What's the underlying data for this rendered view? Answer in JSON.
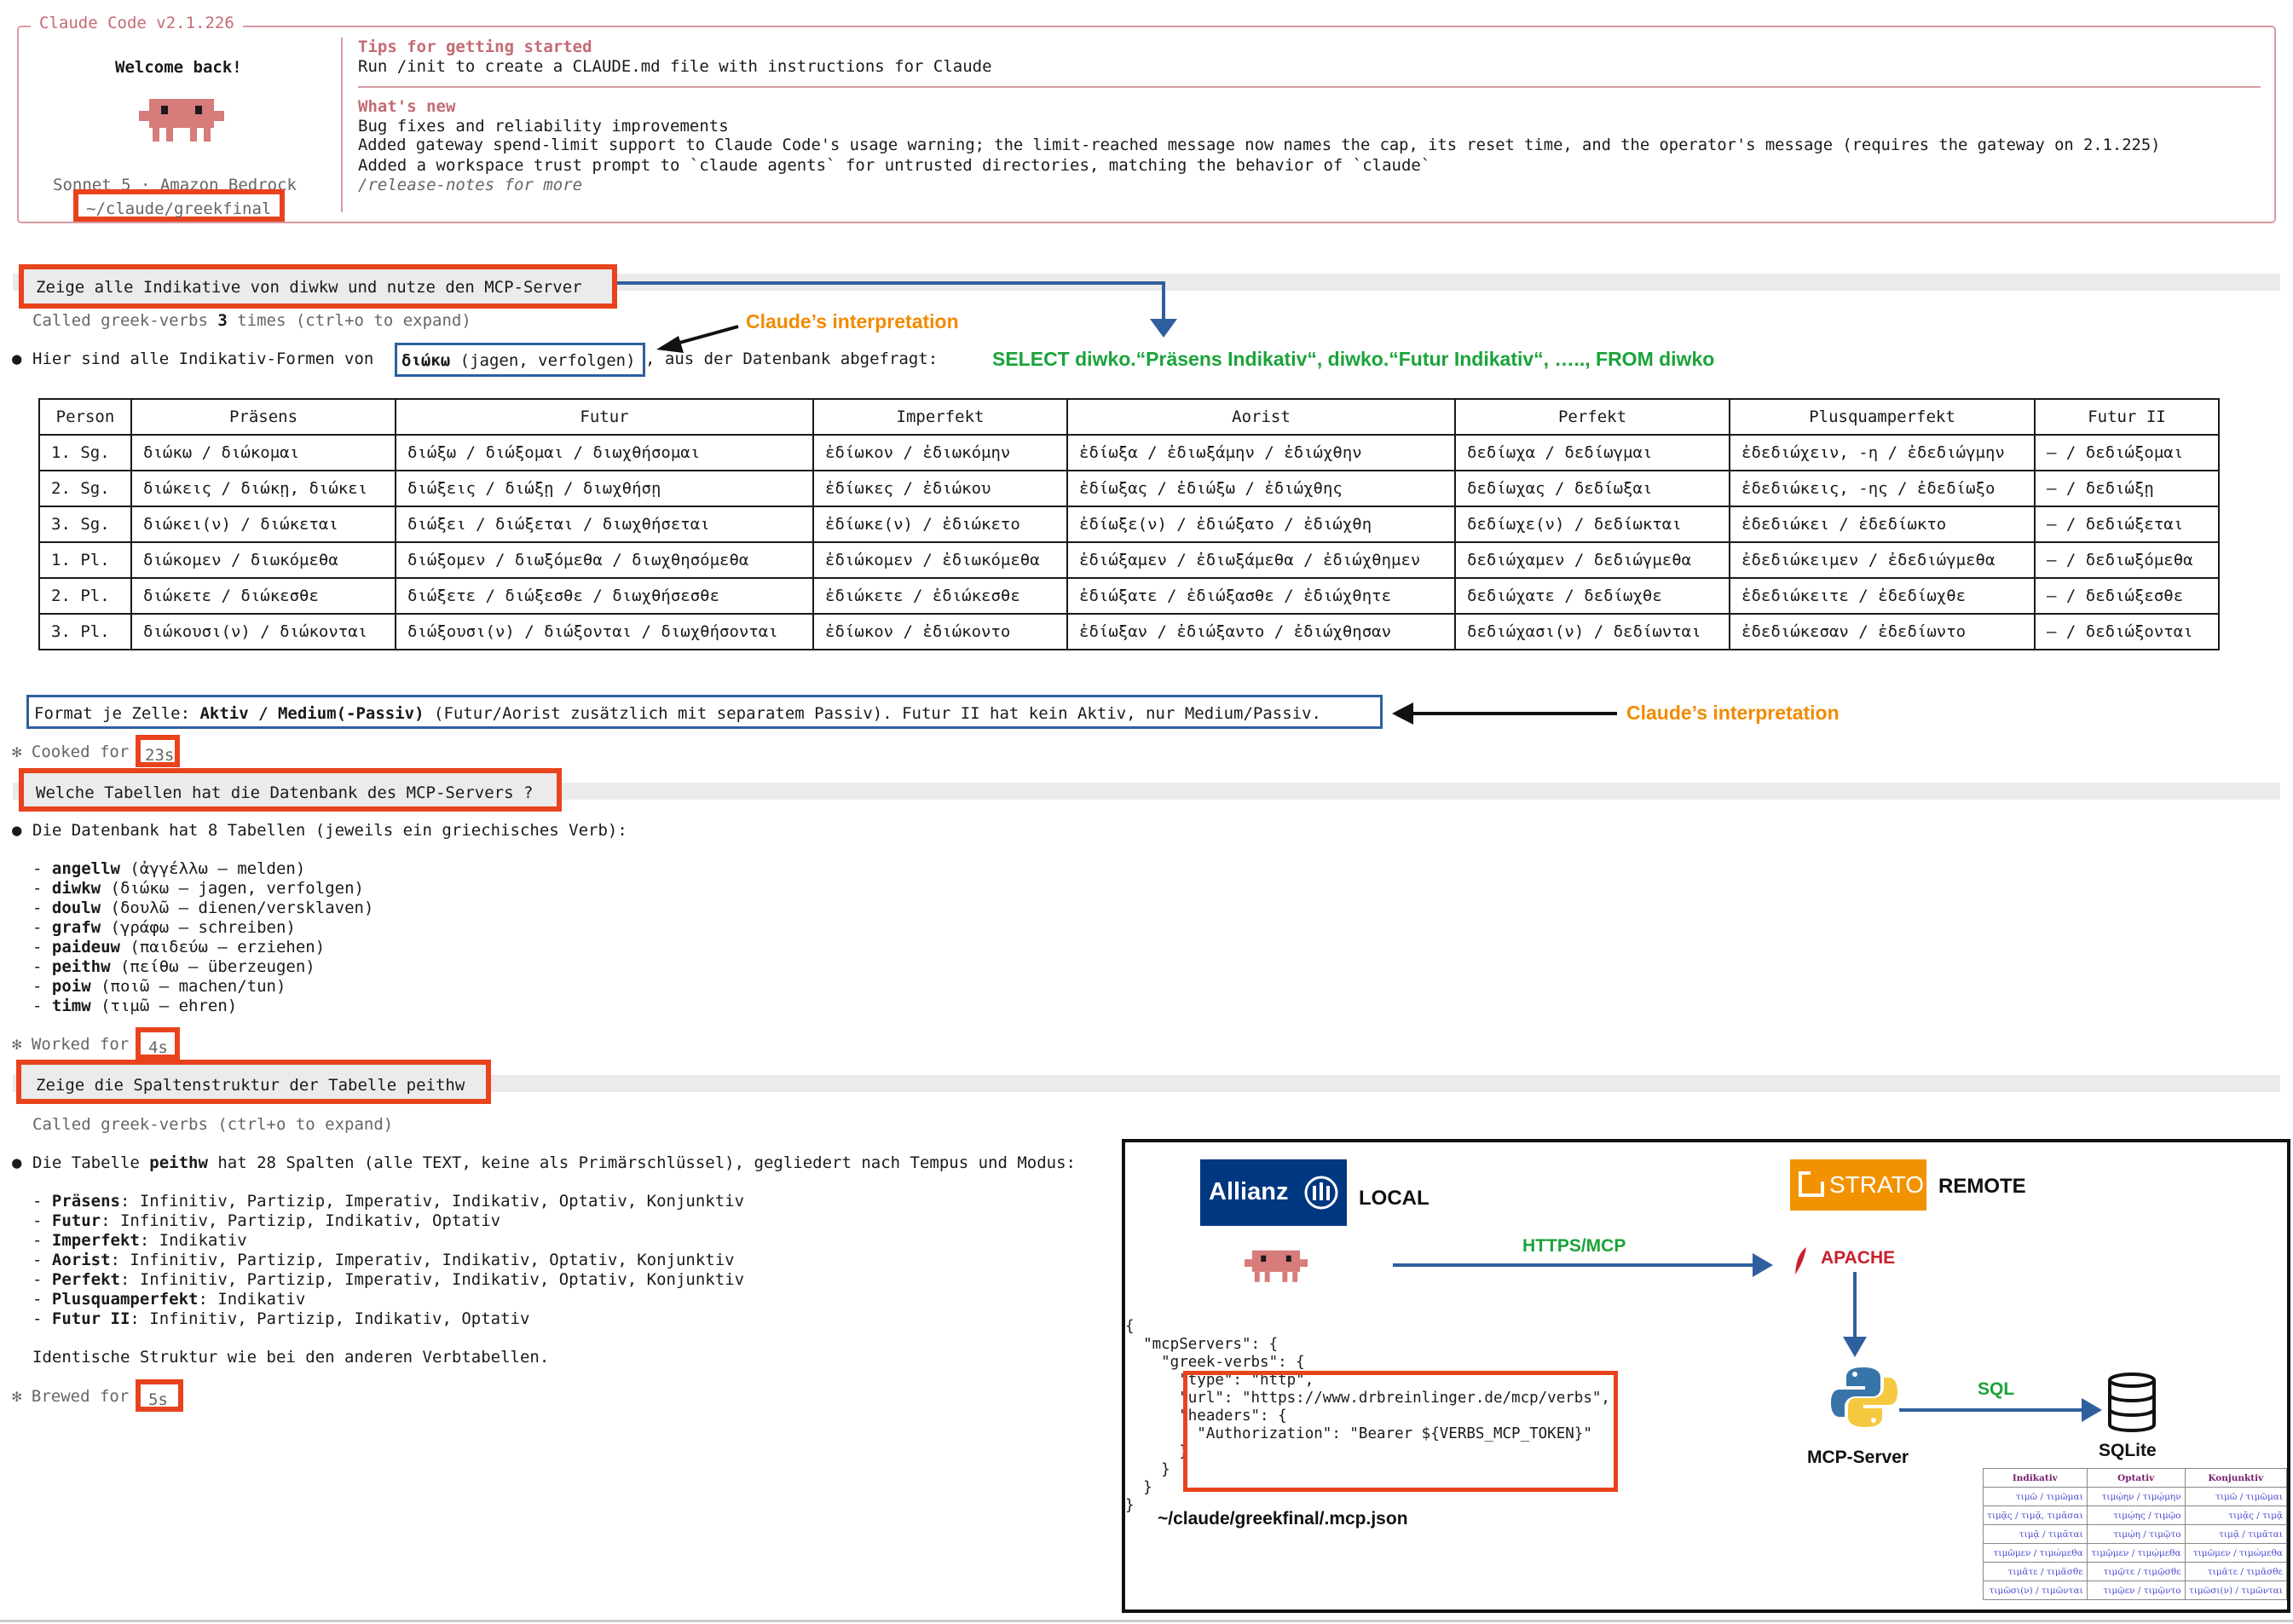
{
  "header": {
    "title": "Claude Code v2.1.226",
    "welcome": "Welcome back!",
    "model": "Sonnet 5 · Amazon Bedrock",
    "cwd": "~/claude/greekfinal",
    "tips_title": "Tips for getting started",
    "tips_text": "Run /init to create a CLAUDE.md file with instructions for Claude",
    "news_title": "What's new",
    "news": [
      "Bug fixes and reliability improvements",
      "Added gateway spend-limit support to Claude Code's usage warning; the limit-reached message now names the cap, its reset time, and the operator's message (requires the gateway on 2.1.225)",
      "Added a workspace trust prompt to `claude agents` for untrusted directories, matching the behavior of `claude`"
    ],
    "release_notes": "/release-notes for more",
    "accent_color": "#c46b74",
    "mascot_color": "#d77b7b"
  },
  "turn1": {
    "prompt": "Zeige alle Indikative von diwkw und nutze den MCP-Server",
    "tool_call_a": "Called greek-verbs ",
    "tool_call_b": "3",
    "tool_call_c": " times (ctrl+o to expand)",
    "bullet": "●",
    "answer_a": "Hier sind alle Indikativ-Formen von ",
    "answer_verb": "διώκω",
    "answer_gloss": " (jagen, verfolgen)",
    "answer_b": ", aus der Datenbank abgefragt:",
    "format_a": "Format je Zelle: ",
    "format_bold": "Aktiv / Medium(-Passiv)",
    "format_b": " (Futur/Aorist zusätzlich mit separatem Passiv). Futur II hat kein Aktiv, nur Medium/Passiv.",
    "status_label": "✻ Cooked for ",
    "status_time": "23s"
  },
  "table": {
    "headers": [
      "Person",
      "Präsens",
      "Futur",
      "Imperfekt",
      "Aorist",
      "Perfekt",
      "Plusquamperfekt",
      "Futur II"
    ],
    "rows": [
      [
        "1. Sg.",
        "διώκω / διώκομαι",
        "διώξω / διώξομαι / διωχθήσομαι",
        "ἐδίωκον / ἐδιωκόμην",
        "ἐδίωξα / ἐδιωξάμην / ἐδιώχθην",
        "δεδίωχα / δεδίωγμαι",
        "ἐδεδιώχειν, -η / ἐδεδιώγμην",
        "– / δεδιώξομαι"
      ],
      [
        "2. Sg.",
        "διώκεις / διώκῃ, διώκει",
        "διώξεις / διώξῃ / διωχθήσῃ",
        "ἐδίωκες / ἐδιώκου",
        "ἐδίωξας / ἐδιώξω / ἐδιώχθης",
        "δεδίωχας / δεδίωξαι",
        "ἐδεδιώκεις, -ης / ἐδεδίωξο",
        "– / δεδιώξῃ"
      ],
      [
        "3. Sg.",
        "διώκει(ν) / διώκεται",
        "διώξει / διώξεται / διωχθήσεται",
        "ἐδίωκε(ν) / ἐδιώκετο",
        "ἐδίωξε(ν) / ἐδιώξατο / ἐδιώχθη",
        "δεδίωχε(ν) / δεδίωκται",
        "ἐδεδιώκει / ἐδεδίωκτο",
        "– / δεδιώξεται"
      ],
      [
        "1. Pl.",
        "διώκομεν / διωκόμεθα",
        "διώξομεν / διωξόμεθα / διωχθησόμεθα",
        "ἐδιώκομεν / ἐδιωκόμεθα",
        "ἐδιώξαμεν / ἐδιωξάμεθα / ἐδιώχθημεν",
        "δεδιώχαμεν / δεδιώγμεθα",
        "ἐδεδιώκειμεν / ἐδεδιώγμεθα",
        "– / δεδιωξόμεθα"
      ],
      [
        "2. Pl.",
        "διώκετε / διώκεσθε",
        "διώξετε / διώξεσθε / διωχθήσεσθε",
        "ἐδιώκετε / ἐδιώκεσθε",
        "ἐδιώξατε / ἐδιώξασθε / ἐδιώχθητε",
        "δεδιώχατε / δεδίωχθε",
        "ἐδεδιώκειτε / ἐδεδίωχθε",
        "– / δεδιώξεσθε"
      ],
      [
        "3. Pl.",
        "διώκουσι(ν) / διώκονται",
        "διώξουσι(ν) / διώξονται / διωχθήσονται",
        "ἐδίωκον / ἐδιώκοντο",
        "ἐδίωξαν / ἐδιώξαντο / ἐδιώχθησαν",
        "δεδιώχασι(ν) / δεδίωνται",
        "ἐδεδιώκεσαν / ἐδεδίωντο",
        "– / δεδιώξονται"
      ]
    ]
  },
  "annotations": {
    "interpretation_1": "Claude’s interpretation",
    "interpretation_2": "Claude’s interpretation",
    "sql": "SELECT diwko.“Präsens Indikativ“, diwko.“Futur Indikativ“, ….., FROM diwko",
    "orange": "#f28a00",
    "green": "#1aa339",
    "red": "#e8431d",
    "blue": "#2f5f9e"
  },
  "turn2": {
    "prompt": "Welche Tabellen hat die Datenbank des MCP-Servers ?",
    "answer": "Die Datenbank hat 8 Tabellen (jeweils ein griechisches Verb):",
    "tables": [
      {
        "name": "angellw",
        "desc": " (ἀγγέλλω – melden)"
      },
      {
        "name": "diwkw",
        "desc": " (διώκω – jagen, verfolgen)"
      },
      {
        "name": "doulw",
        "desc": " (δουλῶ – dienen/versklaven)"
      },
      {
        "name": "grafw",
        "desc": " (γράφω – schreiben)"
      },
      {
        "name": "paideuw",
        "desc": " (παιδεύω – erziehen)"
      },
      {
        "name": "peithw",
        "desc": " (πείθω – überzeugen)"
      },
      {
        "name": "poiw",
        "desc": " (ποιῶ – machen/tun)"
      },
      {
        "name": "timw",
        "desc": " (τιμῶ – ehren)"
      }
    ],
    "status_label": "✻ Worked for ",
    "status_time": "4s"
  },
  "turn3": {
    "prompt": "Zeige die Spaltenstruktur der Tabelle peithw",
    "tool_call": "Called greek-verbs (ctrl+o to expand)",
    "answer_a": "Die Tabelle ",
    "answer_bold": "peithw",
    "answer_b": " hat 28 Spalten (alle TEXT, keine als Primärschlüssel), gegliedert nach Tempus und Modus:",
    "tenses": [
      {
        "name": "Präsens",
        "moods": ": Infinitiv, Partizip, Imperativ, Indikativ, Optativ, Konjunktiv"
      },
      {
        "name": "Futur",
        "moods": ": Infinitiv, Partizip, Indikativ, Optativ"
      },
      {
        "name": "Imperfekt",
        "moods": ": Indikativ"
      },
      {
        "name": "Aorist",
        "moods": ": Infinitiv, Partizip, Imperativ, Indikativ, Optativ, Konjunktiv"
      },
      {
        "name": "Perfekt",
        "moods": ": Infinitiv, Partizip, Imperativ, Indikativ, Optativ, Konjunktiv"
      },
      {
        "name": "Plusquamperfekt",
        "moods": ": Indikativ"
      },
      {
        "name": "Futur II",
        "moods": ": Infinitiv, Partizip, Indikativ, Optativ"
      }
    ],
    "closing": "Identische Struktur wie bei den anderen Verbtabellen.",
    "status_label": "✻ Brewed for ",
    "status_time": "5s"
  },
  "diagram": {
    "allianz_label": "Allianz",
    "local_label": "LOCAL",
    "strato_label": "STRATO",
    "remote_label": "REMOTE",
    "protocol_label": "HTTPS/MCP",
    "apache_label": "APACHE",
    "mcp_server_label": "MCP-Server",
    "sql_label": "SQL",
    "sqlite_label": "SQLite",
    "config_path": "~/claude/greekfinal/.mcp.json",
    "json_lines": [
      "{",
      "  \"mcpServers\": {",
      "    \"greek-verbs\": {",
      "      \"type\": \"http\",",
      "      \"url\": \"https://www.drbreinlinger.de/mcp/verbs\",",
      "      \"headers\": {",
      "        \"Authorization\": \"Bearer ${VERBS_MCP_TOKEN}\"",
      "      }",
      "    }",
      "  }",
      "}"
    ],
    "allianz_color": "#003781",
    "strato_color": "#f39200",
    "apache_color": "#c8202f",
    "mini_table": {
      "headers": [
        "Indikativ",
        "Optativ",
        "Konjunktiv"
      ],
      "rows": [
        [
          "τιμῶ / τιμῶμαι",
          "τιμῴην / τιμῴμην",
          "τιμῶ / τιμῶμαι"
        ],
        [
          "τιμᾷς / τιμᾷ, τιμᾶσαι",
          "τιμῴης / τιμῷο",
          "τιμᾷς / τιμᾷ"
        ],
        [
          "τιμᾷ / τιμᾶται",
          "τιμῴη / τιμῷτο",
          "τιμᾷ / τιμᾶται"
        ],
        [
          "τιμῶμεν / τιμώμεθα",
          "τιμῷμεν / τιμῴμεθα",
          "τιμῶμεν / τιμώμεθα"
        ],
        [
          "τιμᾶτε / τιμᾶσθε",
          "τιμῷτε / τιμῷσθε",
          "τιμᾶτε / τιμᾶσθε"
        ],
        [
          "τιμῶσι(ν) / τιμῶνται",
          "τιμῷεν / τιμῷντο",
          "τιμῶσι(ν) / τιμῶνται"
        ]
      ]
    }
  }
}
